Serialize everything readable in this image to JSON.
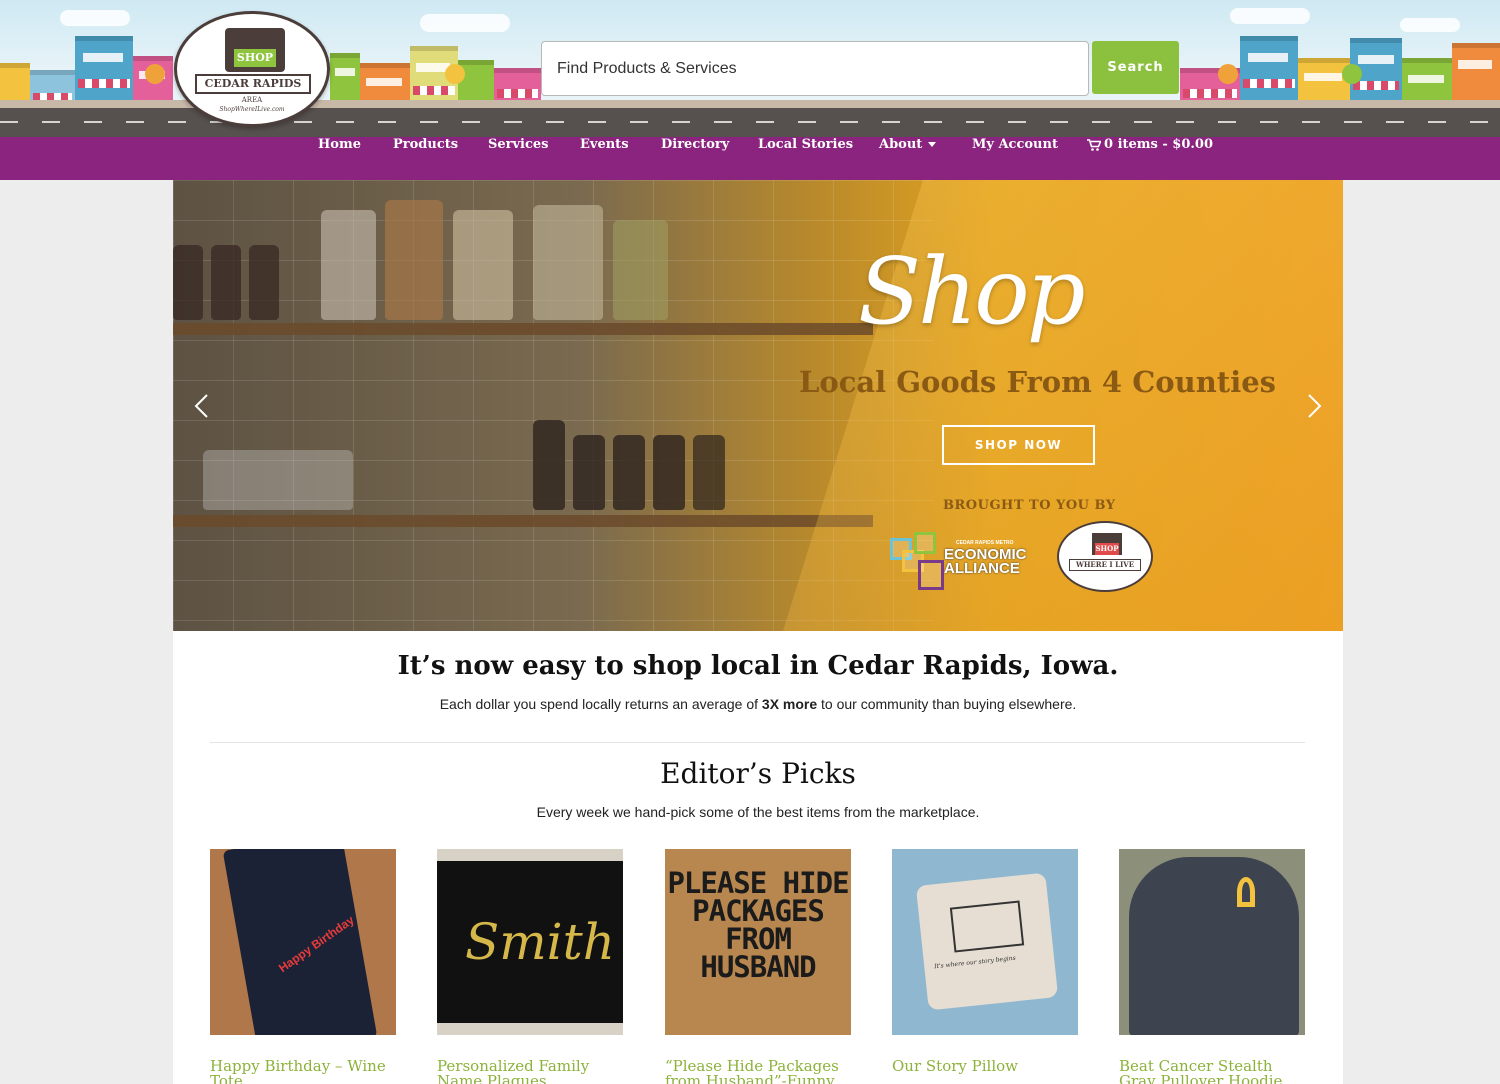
{
  "header": {
    "logo": {
      "shop": "SHOP",
      "city": "CEDAR RAPIDS",
      "area": "AREA",
      "url": "ShopWhereILive.com"
    },
    "search": {
      "placeholder": "Find Products & Services",
      "button_label": "Search"
    }
  },
  "nav": {
    "items": [
      {
        "label": "Home"
      },
      {
        "label": "Products"
      },
      {
        "label": "Services"
      },
      {
        "label": "Events"
      },
      {
        "label": "Directory"
      },
      {
        "label": "Local Stories"
      },
      {
        "label": "About"
      },
      {
        "label": "My Account"
      }
    ],
    "cart_label": "0 items - $0.00"
  },
  "hero": {
    "script_title": "Shop",
    "subtitle": "Local Goods From 4 Counties",
    "button_label": "SHOP NOW",
    "brought_by": "BROUGHT TO YOU BY",
    "partner1_lines": [
      "ECONOMIC",
      "ALLIANCE"
    ],
    "partner1_small": "CEDAR RAPIDS METRO",
    "partner2_shop": "SHOP",
    "partner2_name": "WHERE I LIVE"
  },
  "intro": {
    "title": "It’s now easy to shop local in Cedar Rapids, Iowa.",
    "text_before": "Each dollar you spend locally returns an average of ",
    "text_bold": "3X more",
    "text_after": " to our community than buying elsewhere."
  },
  "picks": {
    "title": "Editor’s Picks",
    "subtitle": "Every week we hand-pick some of the best items from the marketplace.",
    "products": [
      {
        "name": "Happy Birthday – Wine Tote",
        "image_text": "Happy Birthday"
      },
      {
        "name": "Personalized Family Name Plaques",
        "image_text": "Smith"
      },
      {
        "name": "“Please Hide Packages from Husband”-Funny",
        "image_text": "PLEASE HIDE PACKAGES FROM HUSBAND"
      },
      {
        "name": "Our Story Pillow",
        "image_text": "It's where our story begins"
      },
      {
        "name": "Beat Cancer Stealth Gray Pullover Hoodie",
        "image_text": ""
      }
    ]
  },
  "colors": {
    "nav_purple": "#8a247f",
    "search_green": "#8cc13f",
    "product_link_green": "#8cb23a",
    "hero_orange": "#eda528"
  }
}
